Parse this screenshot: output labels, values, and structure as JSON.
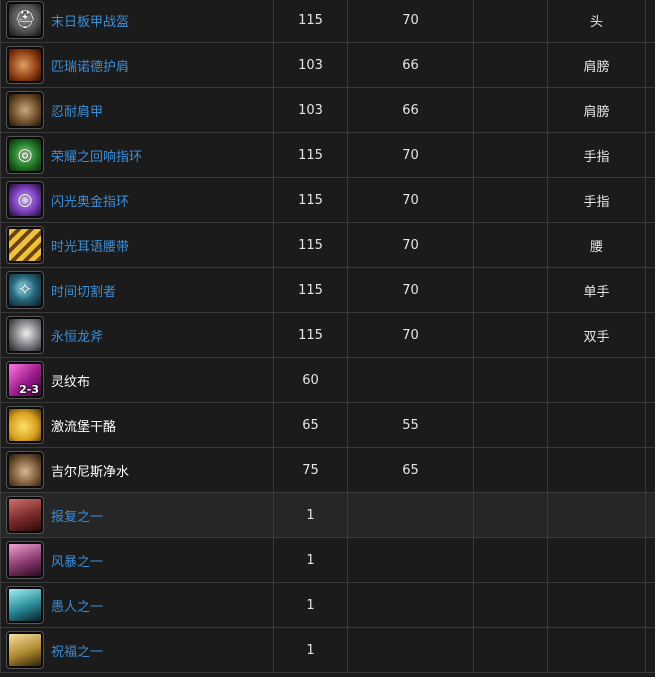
{
  "rows": [
    {
      "icon": "helmet-icon",
      "glyph": "⛑",
      "bg": "radial-gradient(circle at 50% 45%, #a8a8a8, #3a3a3a 70%, #111)",
      "name": "末日板甲战盔",
      "link": true,
      "c1": "115",
      "c2": "70",
      "c3": "",
      "c4": "头"
    },
    {
      "icon": "shoulder-icon",
      "glyph": "",
      "bg": "radial-gradient(circle at 45% 50%, #e0a060, #8a3a10 60%, #2a0a00)",
      "name": "匹瑞诺德护肩",
      "link": true,
      "c1": "103",
      "c2": "66",
      "c3": "",
      "c4": "肩膀"
    },
    {
      "icon": "shoulder-icon",
      "glyph": "",
      "bg": "radial-gradient(circle at 50% 50%, #c8a878, #6a4a28 60%, #201408)",
      "name": "忍耐肩甲",
      "link": true,
      "c1": "103",
      "c2": "66",
      "c3": "",
      "c4": "肩膀"
    },
    {
      "icon": "ring-icon",
      "glyph": "◎",
      "bg": "radial-gradient(circle at 50% 50%, #d8ffd0, #2a8a30 45%, #0a200a)",
      "name": "荣耀之回响指环",
      "link": true,
      "c1": "115",
      "c2": "70",
      "c3": "",
      "c4": "手指"
    },
    {
      "icon": "ring-icon",
      "glyph": "○",
      "bg": "radial-gradient(circle at 50% 50%, #f0e0ff, #8a4ad0 45%, #1a0830)",
      "name": "闪光奥金指环",
      "link": true,
      "c1": "115",
      "c2": "70",
      "c3": "",
      "c4": "手指"
    },
    {
      "icon": "belt-icon",
      "glyph": "",
      "bg": "repeating-linear-gradient(135deg, #f0c040 0 5px, #6a4410 5px 9px)",
      "name": "时光耳语腰带",
      "link": true,
      "c1": "115",
      "c2": "70",
      "c3": "",
      "c4": "腰"
    },
    {
      "icon": "weapon-icon",
      "glyph": "✧",
      "bg": "radial-gradient(circle at 45% 45%, #a0f0ff, #2a6a80 45%, #081820)",
      "name": "时间切割者",
      "link": true,
      "c1": "115",
      "c2": "70",
      "c3": "",
      "c4": "单手"
    },
    {
      "icon": "axe-icon",
      "glyph": "",
      "bg": "radial-gradient(circle at 55% 45%, #f0f0f0, #8a8a90 45%, #1a1a20)",
      "name": "永恒龙斧",
      "link": true,
      "c1": "115",
      "c2": "70",
      "c3": "",
      "c4": "双手"
    },
    {
      "icon": "cloth-icon",
      "glyph": "",
      "bg": "linear-gradient(135deg, #ff7ae0, #9a1a8a 55%, #3a0a3a)",
      "name": "灵纹布",
      "link": false,
      "count": "2-3",
      "c1": "60",
      "c2": "",
      "c3": "",
      "c4": ""
    },
    {
      "icon": "cheese-icon",
      "glyph": "",
      "bg": "radial-gradient(circle at 45% 55%, #ffe06a, #d8a020 55%, #4a3008)",
      "name": "激流堡干酪",
      "link": false,
      "c1": "65",
      "c2": "55",
      "c3": "",
      "c4": ""
    },
    {
      "icon": "water-flask-icon",
      "glyph": "",
      "bg": "radial-gradient(circle at 50% 55%, #d8b890, #7a5a38 55%, #201408)",
      "name": "吉尔尼斯净水",
      "link": false,
      "c1": "75",
      "c2": "65",
      "c3": "",
      "c4": ""
    },
    {
      "icon": "card-icon",
      "glyph": "",
      "bg": "linear-gradient(160deg, #d07070, #7a2a2a 55%, #2a0a0a)",
      "name": "报复之一",
      "link": true,
      "c1": "1",
      "c2": "",
      "c3": "",
      "c4": "",
      "hl": true
    },
    {
      "icon": "card-icon",
      "glyph": "",
      "bg": "linear-gradient(160deg, #f0a0d0, #8a3a70 55%, #2a0a20)",
      "name": "风暴之一",
      "link": true,
      "c1": "1",
      "c2": "",
      "c3": "",
      "c4": ""
    },
    {
      "icon": "card-icon",
      "glyph": "",
      "bg": "linear-gradient(160deg, #a0f0f0, #2a8a9a 55%, #0a2028)",
      "name": "愚人之一",
      "link": true,
      "c1": "1",
      "c2": "",
      "c3": "",
      "c4": ""
    },
    {
      "icon": "card-icon",
      "glyph": "",
      "bg": "linear-gradient(160deg, #f8e0a0, #b08a30 55%, #302008)",
      "name": "祝福之一",
      "link": true,
      "c1": "1",
      "c2": "",
      "c3": "",
      "c4": ""
    }
  ]
}
